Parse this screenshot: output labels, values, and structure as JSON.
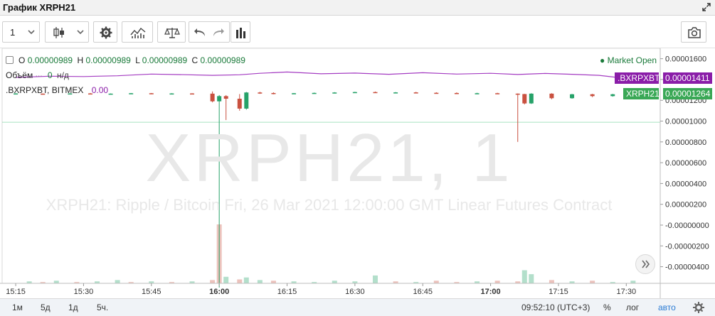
{
  "window": {
    "title": "График XRPH21"
  },
  "toolbar": {
    "interval": "1",
    "icons": [
      "chevron-down-icon",
      "candles-icon",
      "gear-icon",
      "indicators-icon",
      "compare-icon",
      "undo-icon",
      "redo-icon",
      "bars-icon",
      "camera-icon"
    ]
  },
  "legend": {
    "o_key": "O",
    "o_val": "0.00000989",
    "h_key": "H",
    "h_val": "0.00000989",
    "l_key": "L",
    "l_val": "0.00000989",
    "c_key": "C",
    "c_val": "0.00000989",
    "market_status": "● Market Open",
    "volume_label": "Объём",
    "volume_value": "0",
    "volume_unit": "н/д",
    "index_label": ".BXRPXBT, BITMEX",
    "index_value": "0.00"
  },
  "watermark": {
    "big": "XRPH21, 1",
    "desc": "XRPH21: Ripple / Bitcoin Fri, 26 Mar 2021 12:00:00 GMT Linear Futures Contract"
  },
  "bottom": {
    "ranges": [
      "1м",
      "5д",
      "1д",
      "5ч."
    ],
    "clock": "09:52:10 (UTC+3)",
    "percent": "%",
    "log": "лог",
    "auto": "авто"
  },
  "colors": {
    "up": "#26a269",
    "down": "#c9503f",
    "index_line": "#a43cc2",
    "last_price_tag": "#3aa856",
    "index_tag": "#8a1da8",
    "horizontal_line": "#6fcf97"
  },
  "chart_data": {
    "type": "candlestick",
    "title": "XRPH21, 1",
    "x_ticks": [
      "15:15",
      "15:30",
      "15:45",
      "16:00",
      "16:15",
      "16:30",
      "16:45",
      "17:00",
      "17:15",
      "17:30"
    ],
    "bold_ticks": [
      "16:00",
      "17:00"
    ],
    "y_ticks": [
      "0.00001600",
      "0.00001400",
      "0.00001200",
      "0.00001000",
      "0.00000800",
      "0.00000600",
      "0.00000400",
      "0.00000200",
      "-0.00000000",
      "-0.00000200",
      "-0.00000400"
    ],
    "y_range": [
      -5.6e-06,
      1.7e-05
    ],
    "x_range_minutes": [
      -2,
      95
    ],
    "x_axis_origin": "15:15",
    "candles": [
      {
        "t": 0,
        "o": 1.264e-05,
        "h": 1.268e-05,
        "l": 1.26e-05,
        "c": 1.266e-05
      },
      {
        "t": 4,
        "o": 1.264e-05,
        "h": 1.266e-05,
        "l": 1.262e-05,
        "c": 1.263e-05
      },
      {
        "t": 8,
        "o": 1.263e-05,
        "h": 1.268e-05,
        "l": 1.261e-05,
        "c": 1.266e-05
      },
      {
        "t": 11,
        "o": 1.266e-05,
        "h": 1.27e-05,
        "l": 1.262e-05,
        "c": 1.262e-05
      },
      {
        "t": 14,
        "o": 1.262e-05,
        "h": 1.266e-05,
        "l": 1.258e-05,
        "c": 1.264e-05
      },
      {
        "t": 17,
        "o": 1.264e-05,
        "h": 1.27e-05,
        "l": 1.263e-05,
        "c": 1.268e-05
      },
      {
        "t": 20,
        "o": 1.268e-05,
        "h": 1.27e-05,
        "l": 1.262e-05,
        "c": 1.263e-05
      },
      {
        "t": 23,
        "o": 1.263e-05,
        "h": 1.268e-05,
        "l": 1.26e-05,
        "c": 1.266e-05
      },
      {
        "t": 26,
        "o": 1.266e-05,
        "h": 1.268e-05,
        "l": 1.262e-05,
        "c": 1.264e-05
      },
      {
        "t": 29,
        "o": 1.264e-05,
        "h": 1.285e-05,
        "l": 1.18e-05,
        "c": 1.19e-05
      },
      {
        "t": 30,
        "o": 1.19e-05,
        "h": 1.25e-05,
        "l": -6e-06,
        "c": 1.24e-05
      },
      {
        "t": 31,
        "o": 1.24e-05,
        "h": 1.25e-05,
        "l": 1.01e-05,
        "c": 1.215e-05
      },
      {
        "t": 33,
        "o": 1.215e-05,
        "h": 1.26e-05,
        "l": 1.1e-05,
        "c": 1.12e-05
      },
      {
        "t": 34,
        "o": 1.12e-05,
        "h": 1.28e-05,
        "l": 1.11e-05,
        "c": 1.275e-05
      },
      {
        "t": 36,
        "o": 1.275e-05,
        "h": 1.282e-05,
        "l": 1.262e-05,
        "c": 1.27e-05
      },
      {
        "t": 38,
        "o": 1.27e-05,
        "h": 1.276e-05,
        "l": 1.258e-05,
        "c": 1.262e-05
      },
      {
        "t": 41,
        "o": 1.262e-05,
        "h": 1.27e-05,
        "l": 1.26e-05,
        "c": 1.268e-05
      },
      {
        "t": 44,
        "o": 1.268e-05,
        "h": 1.274e-05,
        "l": 1.264e-05,
        "c": 1.271e-05
      },
      {
        "t": 47,
        "o": 1.271e-05,
        "h": 1.278e-05,
        "l": 1.266e-05,
        "c": 1.275e-05
      },
      {
        "t": 50,
        "o": 1.275e-05,
        "h": 1.282e-05,
        "l": 1.27e-05,
        "c": 1.279e-05
      },
      {
        "t": 53,
        "o": 1.279e-05,
        "h": 1.284e-05,
        "l": 1.271e-05,
        "c": 1.274e-05
      },
      {
        "t": 56,
        "o": 1.274e-05,
        "h": 1.279e-05,
        "l": 1.268e-05,
        "c": 1.276e-05
      },
      {
        "t": 59,
        "o": 1.276e-05,
        "h": 1.281e-05,
        "l": 1.27e-05,
        "c": 1.272e-05
      },
      {
        "t": 62,
        "o": 1.272e-05,
        "h": 1.277e-05,
        "l": 1.266e-05,
        "c": 1.27e-05
      },
      {
        "t": 65,
        "o": 1.27e-05,
        "h": 1.276e-05,
        "l": 1.264e-05,
        "c": 1.266e-05
      },
      {
        "t": 68,
        "o": 1.266e-05,
        "h": 1.272e-05,
        "l": 1.262e-05,
        "c": 1.268e-05
      },
      {
        "t": 71,
        "o": 1.268e-05,
        "h": 1.272e-05,
        "l": 1.26e-05,
        "c": 1.264e-05
      },
      {
        "t": 74,
        "o": 1.264e-05,
        "h": 1.266e-05,
        "l": 8e-06,
        "c": 1.26e-05
      },
      {
        "t": 75,
        "o": 1.26e-05,
        "h": 1.262e-05,
        "l": 1.16e-05,
        "c": 1.17e-05
      },
      {
        "t": 76,
        "o": 1.17e-05,
        "h": 1.268e-05,
        "l": 1.165e-05,
        "c": 1.264e-05
      },
      {
        "t": 79,
        "o": 1.264e-05,
        "h": 1.268e-05,
        "l": 1.21e-05,
        "c": 1.22e-05
      },
      {
        "t": 82,
        "o": 1.22e-05,
        "h": 1.262e-05,
        "l": 1.215e-05,
        "c": 1.258e-05
      },
      {
        "t": 85,
        "o": 1.258e-05,
        "h": 1.262e-05,
        "l": 1.23e-05,
        "c": 1.24e-05
      },
      {
        "t": 88,
        "o": 1.24e-05,
        "h": 1.262e-05,
        "l": 1.235e-05,
        "c": 1.258e-05
      },
      {
        "t": 91,
        "o": 1.258e-05,
        "h": 1.266e-05,
        "l": 1.252e-05,
        "c": 1.262e-05
      }
    ],
    "index_line": {
      "name": ".BXRPXBT",
      "t": [
        0,
        5,
        10,
        15,
        20,
        25,
        29,
        33,
        36,
        40,
        45,
        50,
        55,
        60,
        65,
        70,
        74,
        78,
        82,
        86,
        90,
        92
      ],
      "values": [
        1.42e-05,
        1.432e-05,
        1.428e-05,
        1.436e-05,
        1.452e-05,
        1.446e-05,
        1.44e-05,
        1.445e-05,
        1.46e-05,
        1.472e-05,
        1.455e-05,
        1.462e-05,
        1.45e-05,
        1.465e-05,
        1.452e-05,
        1.46e-05,
        1.448e-05,
        1.458e-05,
        1.45e-05,
        1.44e-05,
        1.41e-05,
        1.411e-05
      ]
    },
    "horizontal_line_value": 9.89e-06,
    "volume": {
      "t": [
        2,
        4,
        6,
        9,
        12,
        15,
        17,
        20,
        23,
        26,
        29,
        30,
        31,
        33,
        34,
        36,
        38,
        41,
        44,
        47,
        50,
        53,
        56,
        59,
        62,
        65,
        68,
        71,
        74,
        75,
        76,
        79,
        82,
        85,
        88,
        91
      ],
      "values": [
        3,
        2,
        4,
        2,
        3,
        5,
        2,
        3,
        2,
        3,
        5,
        90,
        10,
        6,
        9,
        5,
        4,
        3,
        2,
        4,
        3,
        12,
        3,
        2,
        4,
        2,
        3,
        4,
        3,
        20,
        14,
        5,
        3,
        4,
        2,
        4
      ],
      "up": [
        true,
        false,
        true,
        false,
        true,
        true,
        false,
        true,
        false,
        true,
        false,
        false,
        true,
        false,
        true,
        true,
        false,
        true,
        true,
        true,
        true,
        true,
        false,
        true,
        false,
        false,
        true,
        false,
        false,
        true,
        true,
        false,
        true,
        false,
        true,
        true
      ]
    },
    "last_price": "0.00001264",
    "last_price_label": "XRPH21",
    "index_last": "0.00001411",
    "index_label": ".BXRPXBT"
  }
}
